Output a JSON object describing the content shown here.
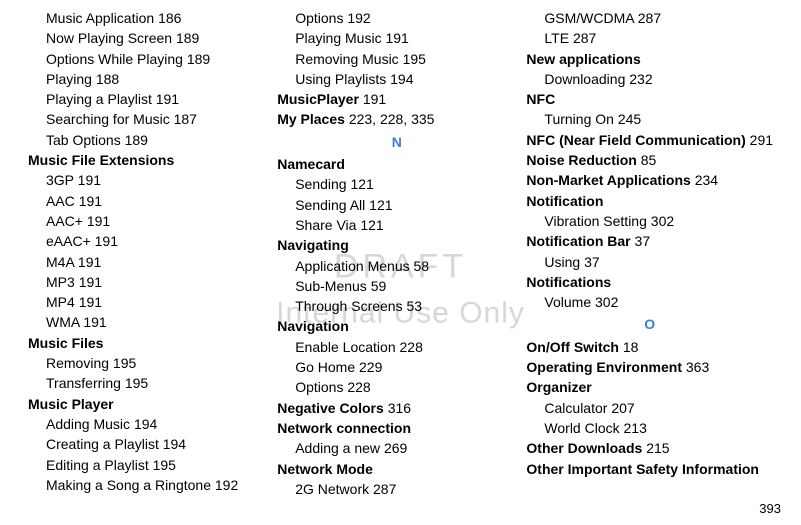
{
  "watermark": {
    "line1": "DRAFT",
    "line2": "Internal Use Only"
  },
  "footer_page": "393",
  "columns": [
    [
      {
        "sub": true,
        "text": "Music Application",
        "page": "186"
      },
      {
        "sub": true,
        "text": "Now Playing Screen",
        "page": "189"
      },
      {
        "sub": true,
        "text": "Options While Playing",
        "page": "189"
      },
      {
        "sub": true,
        "text": "Playing",
        "page": "188"
      },
      {
        "sub": true,
        "text": "Playing a Playlist",
        "page": "191"
      },
      {
        "sub": true,
        "text": "Searching for Music",
        "page": "187"
      },
      {
        "sub": true,
        "text": "Tab Options",
        "page": "189"
      },
      {
        "sub": false,
        "bold": true,
        "text": "Music File Extensions"
      },
      {
        "sub": true,
        "text": "3GP",
        "page": "191"
      },
      {
        "sub": true,
        "text": "AAC",
        "page": "191"
      },
      {
        "sub": true,
        "text": "AAC+",
        "page": "191"
      },
      {
        "sub": true,
        "text": "eAAC+",
        "page": "191"
      },
      {
        "sub": true,
        "text": "M4A",
        "page": "191"
      },
      {
        "sub": true,
        "text": "MP3",
        "page": "191"
      },
      {
        "sub": true,
        "text": "MP4",
        "page": "191"
      },
      {
        "sub": true,
        "text": "WMA",
        "page": "191"
      },
      {
        "sub": false,
        "bold": true,
        "text": "Music Files"
      },
      {
        "sub": true,
        "text": "Removing",
        "page": "195"
      },
      {
        "sub": true,
        "text": "Transferring",
        "page": "195"
      },
      {
        "sub": false,
        "bold": true,
        "text": "Music Player"
      },
      {
        "sub": true,
        "text": "Adding Music",
        "page": "194"
      },
      {
        "sub": true,
        "text": "Creating a Playlist",
        "page": "194"
      },
      {
        "sub": true,
        "text": "Editing a Playlist",
        "page": "195"
      },
      {
        "sub": true,
        "text": "Making a Song a Ringtone",
        "page": "192"
      }
    ],
    [
      {
        "sub": true,
        "text": "Options",
        "page": "192"
      },
      {
        "sub": true,
        "text": "Playing Music",
        "page": "191"
      },
      {
        "sub": true,
        "text": "Removing Music",
        "page": "195"
      },
      {
        "sub": true,
        "text": "Using Playlists",
        "page": "194"
      },
      {
        "sub": false,
        "bold_inline": true,
        "text": "MusicPlayer",
        "page": "191"
      },
      {
        "sub": false,
        "bold_inline": true,
        "text": "My Places",
        "page": "223, 228, 335"
      },
      {
        "letter": "N"
      },
      {
        "sub": false,
        "bold": true,
        "text": "Namecard"
      },
      {
        "sub": true,
        "text": "Sending",
        "page": "121"
      },
      {
        "sub": true,
        "text": "Sending All",
        "page": "121"
      },
      {
        "sub": true,
        "text": "Share Via",
        "page": "121"
      },
      {
        "sub": false,
        "bold": true,
        "text": "Navigating"
      },
      {
        "sub": true,
        "text": "Application Menus",
        "page": "58"
      },
      {
        "sub": true,
        "text": "Sub-Menus",
        "page": "59"
      },
      {
        "sub": true,
        "text": "Through Screens",
        "page": "53"
      },
      {
        "sub": false,
        "bold": true,
        "text": "Navigation"
      },
      {
        "sub": true,
        "text": "Enable Location",
        "page": "228"
      },
      {
        "sub": true,
        "text": "Go Home",
        "page": "229"
      },
      {
        "sub": true,
        "text": "Options",
        "page": "228"
      },
      {
        "sub": false,
        "bold_inline": true,
        "text": "Negative Colors",
        "page": "316"
      },
      {
        "sub": false,
        "bold": true,
        "text": "Network connection"
      },
      {
        "sub": true,
        "text": "Adding a new",
        "page": "269"
      },
      {
        "sub": false,
        "bold": true,
        "text": "Network Mode"
      },
      {
        "sub": true,
        "text": "2G Network",
        "page": "287"
      }
    ],
    [
      {
        "sub": true,
        "text": "GSM/WCDMA",
        "page": "287"
      },
      {
        "sub": true,
        "text": "LTE",
        "page": "287"
      },
      {
        "sub": false,
        "bold": true,
        "text": "New applications"
      },
      {
        "sub": true,
        "text": "Downloading",
        "page": "232"
      },
      {
        "sub": false,
        "bold": true,
        "text": "NFC"
      },
      {
        "sub": true,
        "text": "Turning On",
        "page": "245"
      },
      {
        "sub": false,
        "bold_inline": true,
        "text": "NFC (Near Field Communication)",
        "page": "291"
      },
      {
        "sub": false,
        "bold_inline": true,
        "text": "Noise Reduction",
        "page": "85"
      },
      {
        "sub": false,
        "bold_inline": true,
        "text": "Non-Market Applications",
        "page": "234"
      },
      {
        "sub": false,
        "bold": true,
        "text": "Notification"
      },
      {
        "sub": true,
        "text": "Vibration Setting",
        "page": "302"
      },
      {
        "sub": false,
        "bold_inline": true,
        "text": "Notification Bar",
        "page": "37"
      },
      {
        "sub": true,
        "text": "Using",
        "page": "37"
      },
      {
        "sub": false,
        "bold": true,
        "text": "Notifications"
      },
      {
        "sub": true,
        "text": "Volume",
        "page": "302"
      },
      {
        "letter": "O"
      },
      {
        "sub": false,
        "bold_inline": true,
        "text": "On/Off Switch",
        "page": "18"
      },
      {
        "sub": false,
        "bold_inline": true,
        "text": "Operating Environment",
        "page": "363"
      },
      {
        "sub": false,
        "bold": true,
        "text": "Organizer"
      },
      {
        "sub": true,
        "text": "Calculator",
        "page": "207"
      },
      {
        "sub": true,
        "text": "World Clock",
        "page": "213"
      },
      {
        "sub": false,
        "bold_inline": true,
        "text": "Other Downloads",
        "page": "215"
      },
      {
        "sub": false,
        "bold": true,
        "text": "Other Important Safety Information"
      }
    ]
  ]
}
